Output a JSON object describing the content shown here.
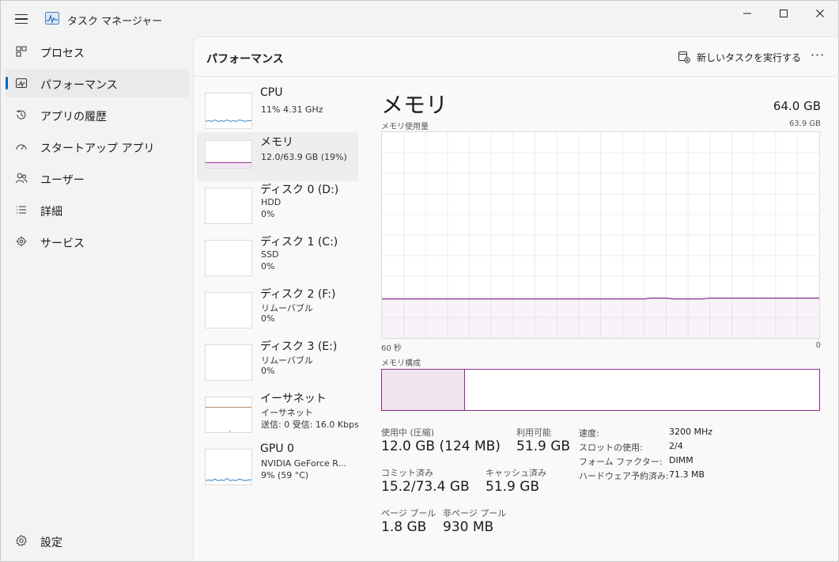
{
  "app": {
    "title": "タスク マネージャー"
  },
  "colors": {
    "accent": "#0067c0",
    "memory": "#8b2f8b",
    "cpu": "#2f7fc1",
    "ethernet": "#a8744d"
  },
  "nav": {
    "items": [
      {
        "label": "プロセス",
        "icon": "processes-icon"
      },
      {
        "label": "パフォーマンス",
        "icon": "performance-icon",
        "active": true
      },
      {
        "label": "アプリの履歴",
        "icon": "history-icon"
      },
      {
        "label": "スタートアップ アプリ",
        "icon": "startup-icon"
      },
      {
        "label": "ユーザー",
        "icon": "users-icon"
      },
      {
        "label": "詳細",
        "icon": "details-icon"
      },
      {
        "label": "サービス",
        "icon": "services-icon"
      }
    ],
    "settings": {
      "label": "設定",
      "icon": "gear-icon"
    }
  },
  "header": {
    "title": "パフォーマンス",
    "run_task_label": "新しいタスクを実行する",
    "more_label": "···"
  },
  "resources": [
    {
      "name": "CPU",
      "line1": "11%  4.31 GHz",
      "line2": ""
    },
    {
      "name": "メモリ",
      "line1": "12.0/63.9 GB (19%)",
      "line2": ""
    },
    {
      "name": "ディスク 0 (D:)",
      "line1": "HDD",
      "line2": "0%"
    },
    {
      "name": "ディスク 1 (C:)",
      "line1": "SSD",
      "line2": "0%"
    },
    {
      "name": "ディスク 2 (F:)",
      "line1": "リムーバブル",
      "line2": "0%"
    },
    {
      "name": "ディスク 3 (E:)",
      "line1": "リムーバブル",
      "line2": "0%"
    },
    {
      "name": "イーサネット",
      "line1": "イーサネット",
      "line2": "送信: 0  受信: 16.0 Kbps"
    },
    {
      "name": "GPU 0",
      "line1": "NVIDIA GeForce R...",
      "line2": "9%  (59 °C)"
    }
  ],
  "detail": {
    "title": "メモリ",
    "total": "64.0 GB",
    "usage_label": "メモリ使用量",
    "usage_max": "63.9 GB",
    "axis_left": "60 秒",
    "axis_right": "0",
    "composition_label": "メモリ構成",
    "composition_used_fraction": 0.19,
    "usage_fraction": 0.19,
    "stats": {
      "in_use_label": "使用中 (圧縮)",
      "in_use_value": "12.0 GB (124 MB)",
      "available_label": "利用可能",
      "available_value": "51.9 GB",
      "committed_label": "コミット済み",
      "committed_value": "15.2/73.4 GB",
      "cached_label": "キャッシュ済み",
      "cached_value": "51.9 GB",
      "paged_pool_label": "ページ プール",
      "paged_pool_value": "1.8 GB",
      "nonpaged_pool_label": "非ページ プール",
      "nonpaged_pool_value": "930 MB"
    },
    "props": [
      {
        "key": "速度:",
        "value": "3200 MHz"
      },
      {
        "key": "スロットの使用:",
        "value": "2/4"
      },
      {
        "key": "フォーム ファクター:",
        "value": "DIMM"
      },
      {
        "key": "ハードウェア予約済み:",
        "value": "71.3 MB"
      }
    ]
  }
}
